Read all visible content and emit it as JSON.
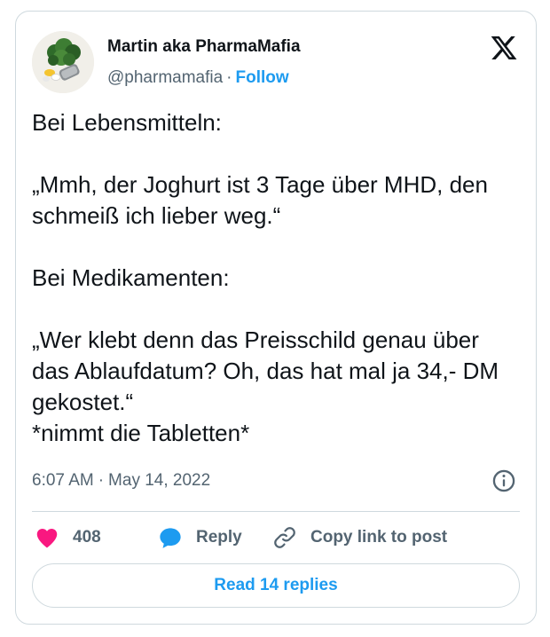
{
  "author": {
    "name": "Martin aka PharmaMafia",
    "handle": "@pharmamafia",
    "separator": "·",
    "follow_label": "Follow",
    "avatar_icon": "plant-pills-avatar"
  },
  "platform_icon": "x-logo-icon",
  "tweet": {
    "text": "Bei Lebensmitteln:\n\n„Mmh, der Joghurt ist 3 Tage über MHD, den schmeiß ich lieber weg.“\n\nBei Medikamenten:\n\n„Wer klebt denn das Preisschild genau über das Ablaufdatum? Oh, das hat mal ja 34,- DM gekostet.“\n*nimmt die Tabletten*",
    "time": "6:07 AM",
    "date": "May 14, 2022",
    "meta_separator": "·"
  },
  "actions": {
    "like_count": "408",
    "reply_label": "Reply",
    "copy_label": "Copy link to post"
  },
  "read_replies_label": "Read 14 replies",
  "colors": {
    "accent": "#1d9bf0",
    "like": "#f91880",
    "text": "#0f1419",
    "secondary": "#536471",
    "border": "#cfd9de"
  }
}
